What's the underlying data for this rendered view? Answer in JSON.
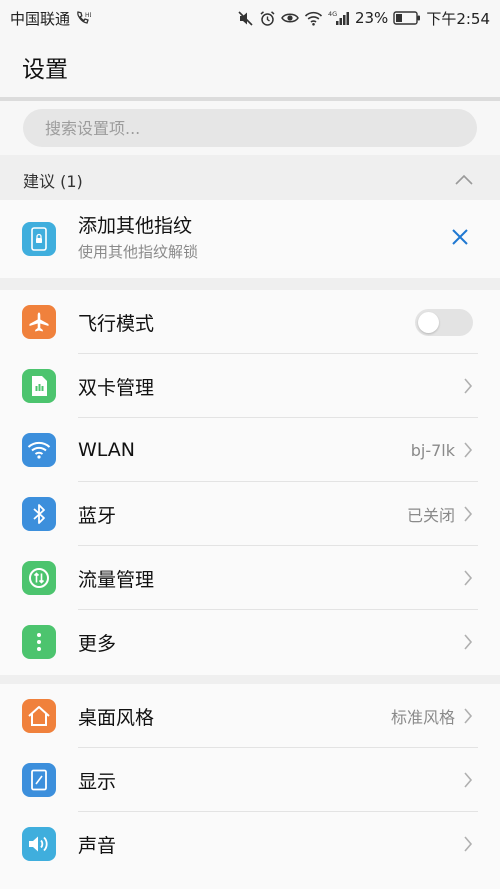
{
  "status_bar": {
    "carrier": "中国联通",
    "battery_percent": "23%",
    "time": "下午2:54",
    "network_type": "4G",
    "icons": [
      "hd-call-icon",
      "mute-icon",
      "alarm-icon",
      "eye-comfort-icon",
      "wifi-icon",
      "signal-icon",
      "battery-icon"
    ]
  },
  "appbar": {
    "title": "设置"
  },
  "search": {
    "placeholder": "搜索设置项..."
  },
  "suggestions": {
    "header": "建议 (1)",
    "item": {
      "title": "添加其他指纹",
      "subtitle": "使用其他指纹解锁",
      "icon": "fingerprint-phone-icon"
    }
  },
  "group1": {
    "items": [
      {
        "label": "飞行模式",
        "icon": "airplane-icon",
        "color": "#f0813c",
        "toggle": false
      },
      {
        "label": "双卡管理",
        "icon": "sim-card-icon",
        "color": "#4cc46e"
      },
      {
        "label": "WLAN",
        "icon": "wifi-icon",
        "color": "#3c8fdc",
        "value": "bj-7lk"
      },
      {
        "label": "蓝牙",
        "icon": "bluetooth-icon",
        "color": "#3c8fdc",
        "value": "已关闭"
      },
      {
        "label": "流量管理",
        "icon": "data-usage-icon",
        "color": "#4cc46e"
      },
      {
        "label": "更多",
        "icon": "more-icon",
        "color": "#4cc46e"
      }
    ]
  },
  "group2": {
    "items": [
      {
        "label": "桌面风格",
        "icon": "home-icon",
        "color": "#f0813c",
        "value": "标准风格"
      },
      {
        "label": "显示",
        "icon": "display-icon",
        "color": "#3c8fdc"
      },
      {
        "label": "声音",
        "icon": "sound-icon",
        "color": "#3faedd"
      }
    ]
  },
  "colors": {
    "accent": "#1f78d1",
    "background": "#efefef",
    "card": "#fafafa"
  }
}
